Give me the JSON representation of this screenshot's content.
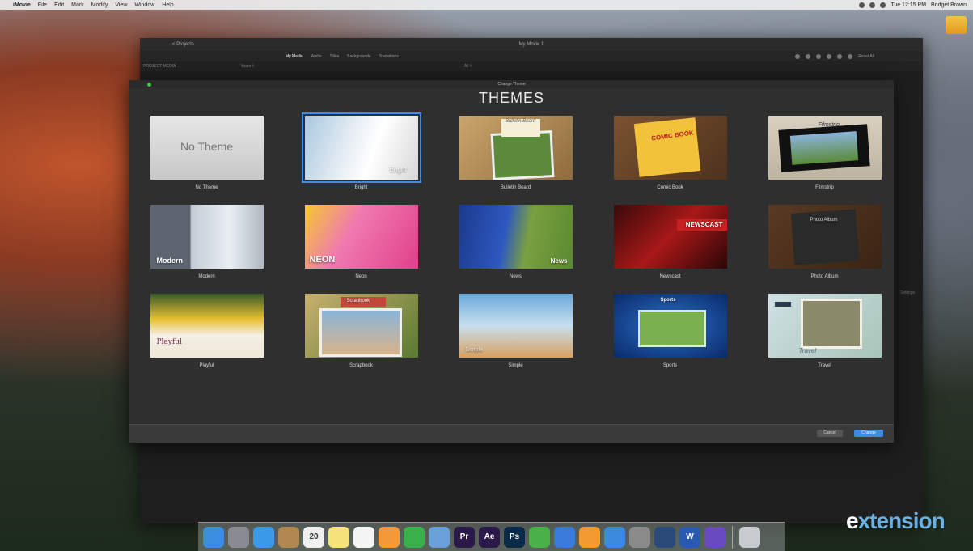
{
  "menubar": {
    "items": [
      "iMovie",
      "File",
      "Edit",
      "Mark",
      "Modify",
      "View",
      "Window",
      "Help"
    ],
    "clock": "Tue 12:15 PM",
    "user": "Bridget Brown"
  },
  "imovie": {
    "back_label": "< Projects",
    "window_title": "My Movie 1",
    "tabs": [
      "My Media",
      "Audio",
      "Titles",
      "Backgrounds",
      "Transitions"
    ],
    "active_tab": "My Media",
    "project_media_label": "PROJECT MEDIA",
    "years_label": "Years ◊",
    "all_filter": "All ◊",
    "reset_all": "Reset All",
    "settings_label": "Settings"
  },
  "sheet": {
    "window_title": "Change Theme",
    "heading": "THEMES",
    "selected": "Bright",
    "themes": [
      {
        "name": "No Theme",
        "overlay": "No Theme"
      },
      {
        "name": "Bright",
        "overlay": "Bright"
      },
      {
        "name": "Bulletin Board",
        "overlay": "Bulletin Board"
      },
      {
        "name": "Comic Book",
        "overlay": "COMIC BOOK"
      },
      {
        "name": "Filmstrip",
        "overlay": "Filmstrip"
      },
      {
        "name": "Modern",
        "overlay": "Modern"
      },
      {
        "name": "Neon",
        "overlay": "NEON"
      },
      {
        "name": "News",
        "overlay": "News"
      },
      {
        "name": "Newscast",
        "overlay": "NEWSCAST"
      },
      {
        "name": "Photo Album",
        "overlay": "Photo Album"
      },
      {
        "name": "Playful",
        "overlay": "Playful"
      },
      {
        "name": "Scrapbook",
        "overlay": "Scrapbook"
      },
      {
        "name": "Simple",
        "overlay": "Simple"
      },
      {
        "name": "Sports",
        "overlay": "Sports"
      },
      {
        "name": "Travel",
        "overlay": "Travel"
      }
    ],
    "cancel_label": "Cancel",
    "change_label": "Change"
  },
  "dock": {
    "apps": [
      {
        "icon": "finder-icon",
        "color": "#3b8de0"
      },
      {
        "icon": "launchpad-icon",
        "color": "#8a8a92"
      },
      {
        "icon": "safari-icon",
        "color": "#3a9ae8"
      },
      {
        "icon": "contacts-icon",
        "color": "#b08850"
      },
      {
        "icon": "calendar-icon",
        "color": "#f0f0f0",
        "text": "20"
      },
      {
        "icon": "notes-icon",
        "color": "#f6e27a"
      },
      {
        "icon": "reminders-icon",
        "color": "#f4f4f4"
      },
      {
        "icon": "photos-icon",
        "color": "#f29a3a"
      },
      {
        "icon": "facetime-icon",
        "color": "#3ab04a"
      },
      {
        "icon": "preview-icon",
        "color": "#6aa0d8"
      },
      {
        "icon": "premiere-icon",
        "color": "#2a1a4a",
        "text": "Pr"
      },
      {
        "icon": "after-effects-icon",
        "color": "#2a1a4a",
        "text": "Ae"
      },
      {
        "icon": "photoshop-icon",
        "color": "#0a2a4a",
        "text": "Ps"
      },
      {
        "icon": "numbers-icon",
        "color": "#4ab04a"
      },
      {
        "icon": "keynote-icon",
        "color": "#3a7ad8"
      },
      {
        "icon": "ibooks-icon",
        "color": "#f09a30"
      },
      {
        "icon": "app-store-icon",
        "color": "#3a8ae0"
      },
      {
        "icon": "system-preferences-icon",
        "color": "#8a8a8a"
      },
      {
        "icon": "quicktime-icon",
        "color": "#2a4a7a"
      },
      {
        "icon": "word-icon",
        "color": "#2a5ab0",
        "text": "W"
      },
      {
        "icon": "imovie-icon",
        "color": "#6a4ac0"
      }
    ],
    "trash_icon": "trash-icon"
  },
  "watermark": {
    "prefix": "e",
    "rest": "xtension"
  }
}
